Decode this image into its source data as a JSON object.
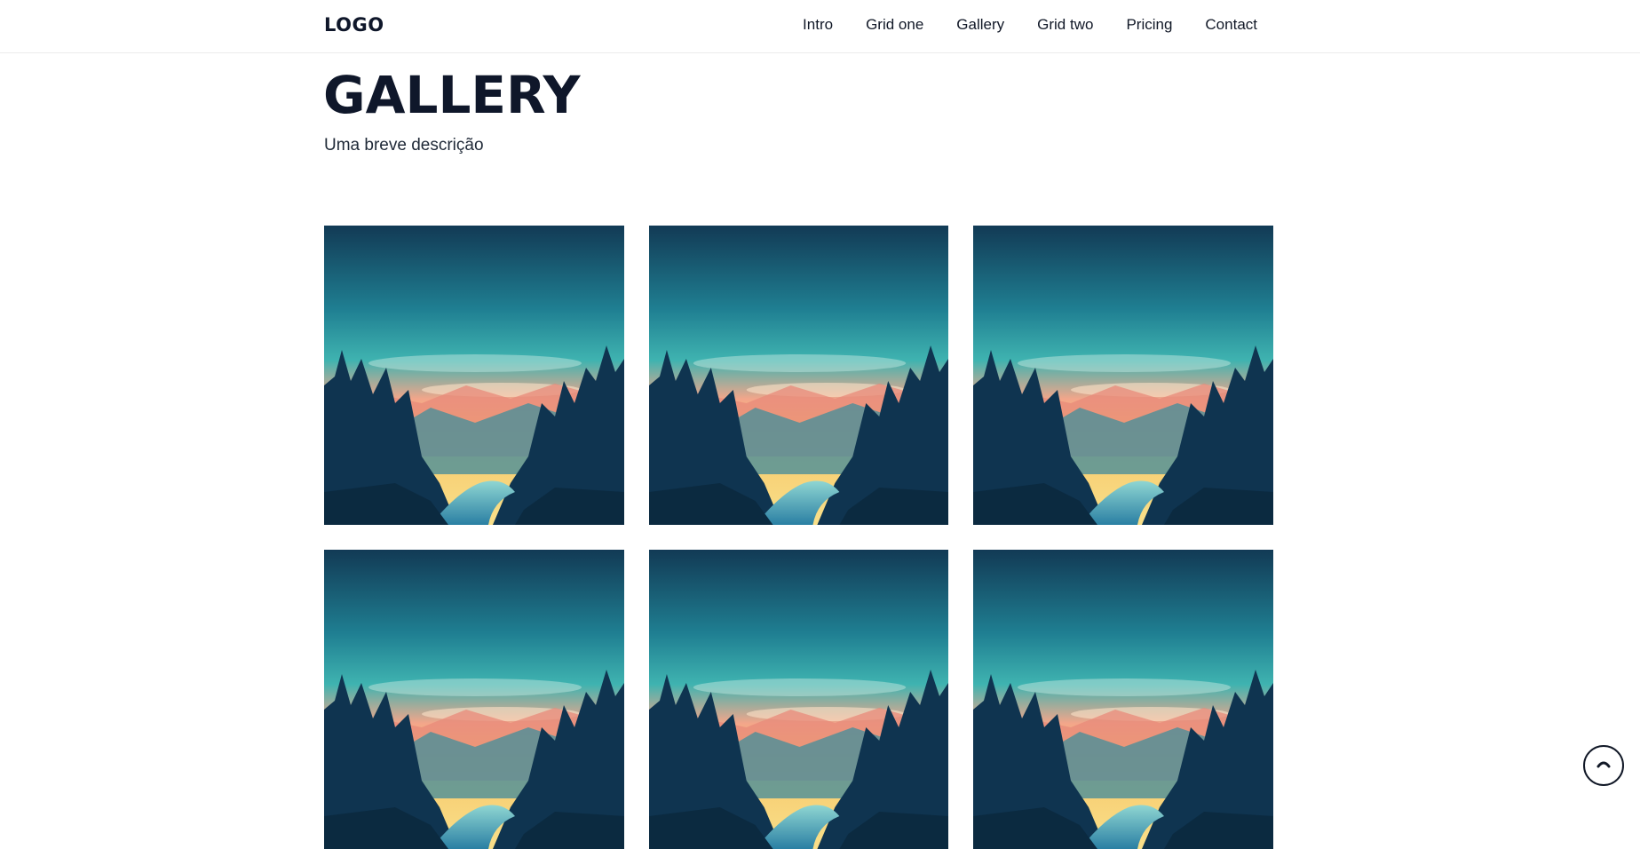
{
  "header": {
    "logo": "LOGO",
    "nav": [
      {
        "label": "Intro"
      },
      {
        "label": "Grid one"
      },
      {
        "label": "Gallery"
      },
      {
        "label": "Grid two"
      },
      {
        "label": "Pricing"
      },
      {
        "label": "Contact"
      }
    ]
  },
  "main": {
    "title": "GALLERY",
    "subtitle": "Uma breve descrição",
    "gallery": {
      "images": [
        {
          "subject": "forest-sunset-landscape"
        },
        {
          "subject": "forest-sunset-landscape"
        },
        {
          "subject": "forest-sunset-landscape"
        },
        {
          "subject": "forest-sunset-landscape"
        },
        {
          "subject": "forest-sunset-landscape"
        },
        {
          "subject": "forest-sunset-landscape"
        }
      ]
    }
  },
  "scroll_top": {
    "icon": "chevron-up-icon"
  },
  "colors": {
    "text": "#111827",
    "title": "#0f172a",
    "sky_top": "#123a55",
    "sky_mid": "#3fb3b0",
    "sunset": "#f6c76a",
    "forest": "#0f3450",
    "river": "#2a7fa3"
  }
}
